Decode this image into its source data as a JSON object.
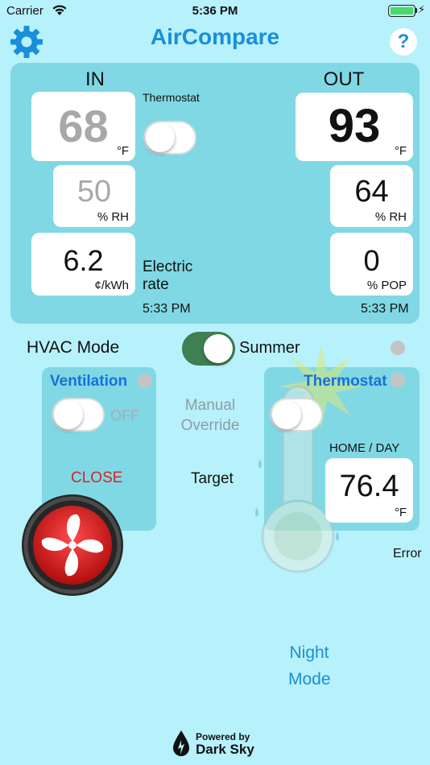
{
  "status_bar": {
    "carrier": "Carrier",
    "time": "5:36 PM"
  },
  "header": {
    "title": "AirCompare",
    "settings_icon": "gear-icon",
    "help_icon": "?"
  },
  "indoor": {
    "label": "IN",
    "temperature": "68",
    "temperature_unit": "°F",
    "humidity": "50",
    "humidity_unit": "% RH",
    "rate": "6.2",
    "rate_unit": "¢/kWh",
    "rate_label": "Electric rate",
    "updated": "5:33 PM"
  },
  "outdoor": {
    "label": "OUT",
    "temperature": "93",
    "temperature_unit": "°F",
    "humidity": "64",
    "humidity_unit": "% RH",
    "pop": "0",
    "pop_unit": "% POP",
    "updated": "5:33 PM"
  },
  "thermostat_toggle": {
    "label": "Thermostat",
    "on": false
  },
  "hvac": {
    "label": "HVAC Mode",
    "mode": "Summer",
    "on": true
  },
  "ventilation": {
    "title": "Ventilation",
    "state": "OFF",
    "action": "CLOSE",
    "fan_icon": "fan-icon"
  },
  "manual_override": {
    "label": "Manual Override"
  },
  "target": {
    "label": "Target"
  },
  "thermostat_panel": {
    "title": "Thermostat",
    "schedule": "HOME /  DAY",
    "target_temp": "76.4",
    "target_unit": "°F",
    "status": "Error"
  },
  "night_mode": {
    "label": "Night Mode"
  },
  "footer": {
    "powered_by": "Powered by",
    "provider": "Dark Sky"
  },
  "colors": {
    "background": "#b7f1fb",
    "panel": "#80d8e4",
    "accent_blue": "#1a8fd8",
    "toggle_on": "#3f7f52",
    "close_red": "#d32626"
  }
}
